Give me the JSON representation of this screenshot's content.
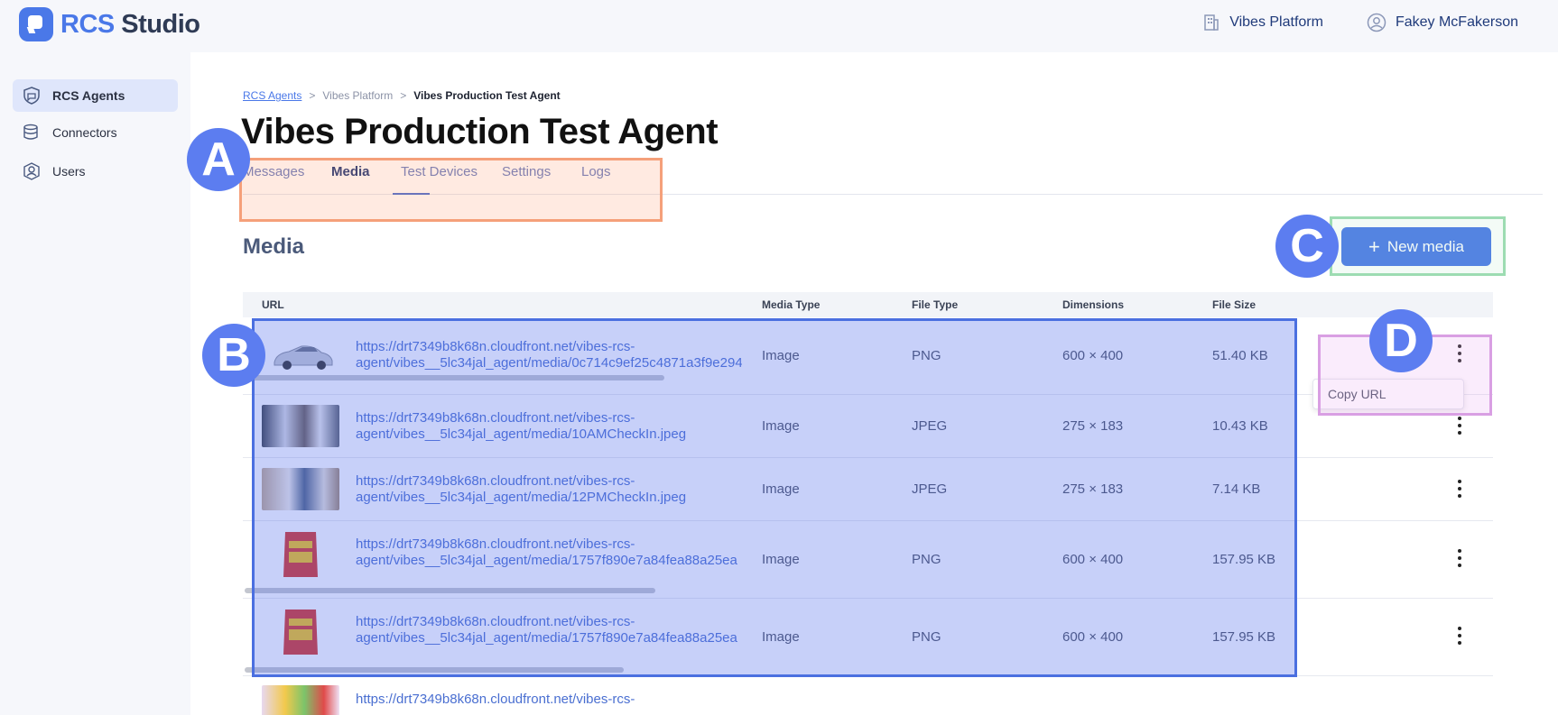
{
  "brand": {
    "rcs": "RCS",
    "studio": "Studio"
  },
  "header": {
    "org": "Vibes Platform",
    "user": "Fakey McFakerson"
  },
  "sidebar": {
    "items": [
      {
        "label": "RCS Agents",
        "icon": "shield-chat-icon"
      },
      {
        "label": "Connectors",
        "icon": "database-icon"
      },
      {
        "label": "Users",
        "icon": "user-icon"
      }
    ]
  },
  "breadcrumb": {
    "root": "RCS Agents",
    "sep": ">",
    "org": "Vibes Platform",
    "current": "Vibes Production Test Agent"
  },
  "page_title": "Vibes Production Test Agent",
  "tabs": [
    "Messages",
    "Media",
    "Test Devices",
    "Settings",
    "Logs"
  ],
  "section": {
    "title": "Media",
    "new_button": "New media",
    "new_icon": "+"
  },
  "table": {
    "columns": [
      "URL",
      "Media Type",
      "File Type",
      "Dimensions",
      "File Size"
    ],
    "rows": [
      {
        "url1": "https://drt7349b8k68n.cloudfront.net/vibes-rcs-",
        "url2": "agent/vibes__5lc34jal_agent/media/0c714c9ef25c4871a3f9e294",
        "type": "Image",
        "ftype": "PNG",
        "dim": "600 × 400",
        "size": "51.40 KB"
      },
      {
        "url1": "https://drt7349b8k68n.cloudfront.net/vibes-rcs-",
        "url2": "agent/vibes__5lc34jal_agent/media/10AMCheckIn.jpeg",
        "type": "Image",
        "ftype": "JPEG",
        "dim": "275 × 183",
        "size": "10.43 KB"
      },
      {
        "url1": "https://drt7349b8k68n.cloudfront.net/vibes-rcs-",
        "url2": "agent/vibes__5lc34jal_agent/media/12PMCheckIn.jpeg",
        "type": "Image",
        "ftype": "JPEG",
        "dim": "275 × 183",
        "size": "7.14 KB"
      },
      {
        "url1": "https://drt7349b8k68n.cloudfront.net/vibes-rcs-",
        "url2": "agent/vibes__5lc34jal_agent/media/1757f890e7a84fea88a25ea",
        "type": "Image",
        "ftype": "PNG",
        "dim": "600 × 400",
        "size": "157.95 KB"
      },
      {
        "url1": "https://drt7349b8k68n.cloudfront.net/vibes-rcs-",
        "url2": "agent/vibes__5lc34jal_agent/media/1757f890e7a84fea88a25ea",
        "type": "Image",
        "ftype": "PNG",
        "dim": "600 × 400",
        "size": "157.95 KB"
      },
      {
        "url1": "https://drt7349b8k68n.cloudfront.net/vibes-rcs-",
        "url2": "",
        "type": "",
        "ftype": "",
        "dim": "",
        "size": ""
      }
    ]
  },
  "menu": {
    "copy_url": "Copy URL"
  },
  "annotations": {
    "a": "A",
    "b": "B",
    "c": "C",
    "d": "D"
  }
}
